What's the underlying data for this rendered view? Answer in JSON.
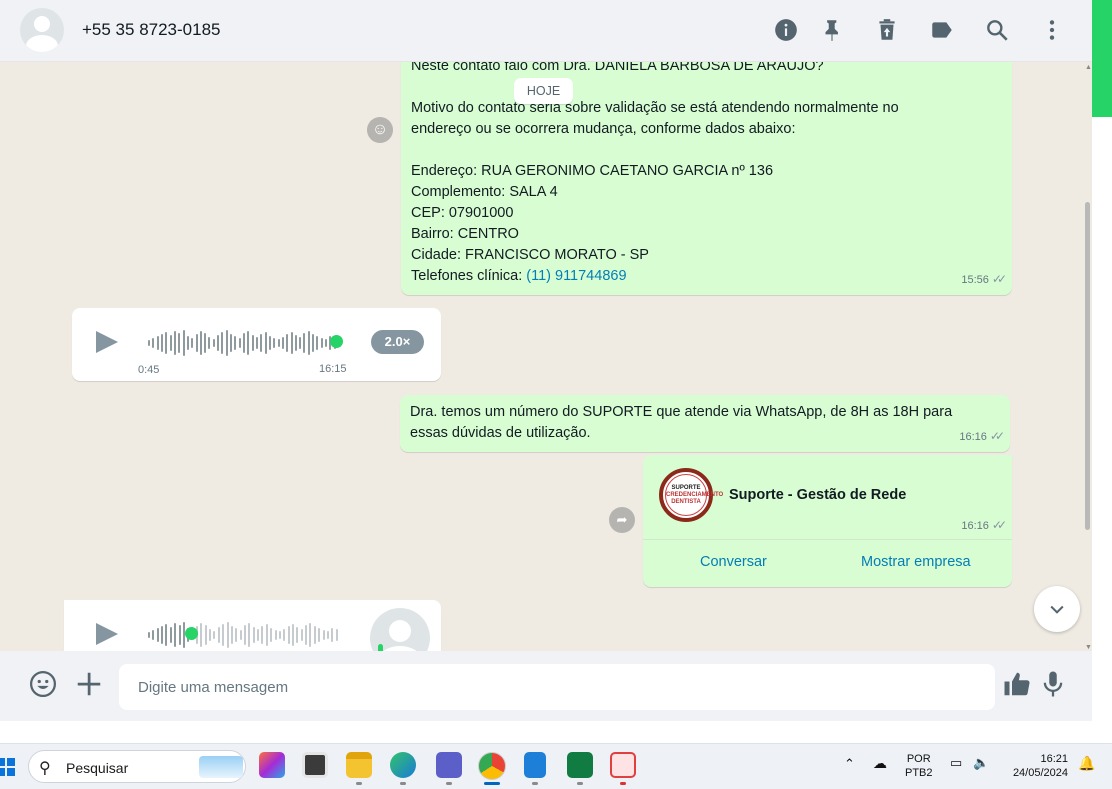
{
  "header": {
    "contact_name": "+55 35 8723-0185",
    "icons": [
      "info-icon",
      "pin-icon",
      "delete-icon",
      "label-icon",
      "search-icon",
      "menu-icon"
    ]
  },
  "chat": {
    "date_divider": "HOJE",
    "messages": {
      "msg1": {
        "lines": [
          "Neste contato falo com Dra. DANIELA BARBOSA DE ARAUJO?",
          "",
          "Motivo do contato seria sobre validação se está atendendo normalmente no",
          "endereço ou se ocorrera mudança, conforme dados abaixo:",
          "",
          "Endereço: RUA GERONIMO CAETANO GARCIA nº 136",
          "Complemento: SALA 4",
          "CEP: 07901000",
          "Bairro: CENTRO",
          "Cidade: FRANCISCO MORATO - SP"
        ],
        "phone_label": "Telefones clínica: ",
        "phone_link": "(11) 911744869",
        "time": "15:56"
      },
      "audio1": {
        "duration": "0:45",
        "time": "16:15",
        "speed": "2.0×",
        "progress": 1.0
      },
      "msg2": {
        "text_line1": "Dra. temos um número do SUPORTE que atende via WhatsApp, de 8H as 18H para",
        "text_line2": "essas dúvidas de utilização.",
        "time": "16:16"
      },
      "contact_card": {
        "name": "Suporte - Gestão de Rede",
        "logo_text_top": "SUPORTE",
        "logo_text_mid": "CREDENCIAMENTO DENTISTA",
        "time": "16:16",
        "btn_chat": "Conversar",
        "btn_show": "Mostrar empresa"
      },
      "audio2": {
        "progress": 0.22
      }
    }
  },
  "footer": {
    "placeholder": "Digite uma mensagem"
  },
  "taskbar": {
    "search_placeholder": "Pesquisar",
    "lang_top": "POR",
    "lang_bottom": "PTB2",
    "time": "16:21",
    "date": "24/05/2024"
  },
  "colors": {
    "outgoing_bubble": "#d9fdd3",
    "incoming_bubble": "#ffffff",
    "chat_bg": "#efeae2",
    "accent_green": "#25d366",
    "link": "#027eb5"
  }
}
